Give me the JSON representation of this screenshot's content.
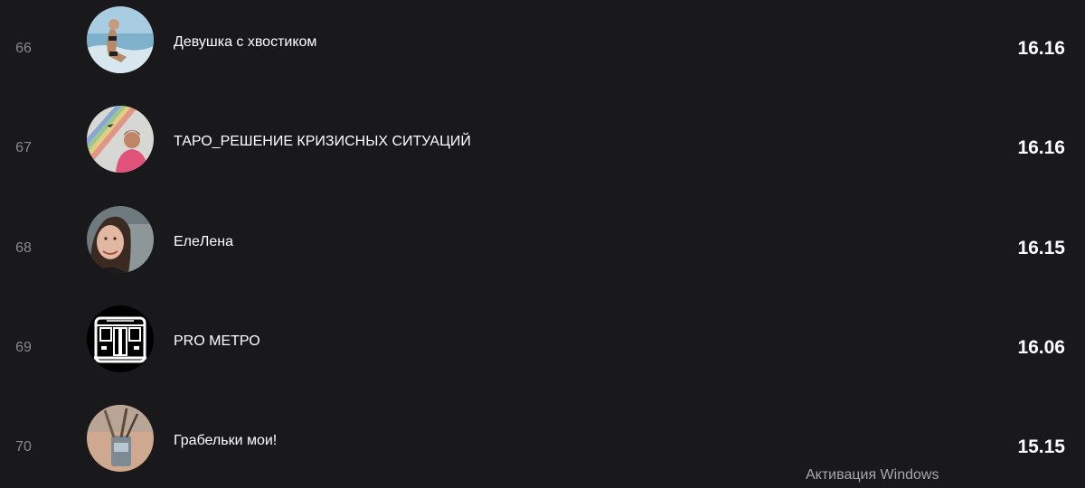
{
  "rows": [
    {
      "rank": "66",
      "name": "Девушка с хвостиком",
      "score": "16.16"
    },
    {
      "rank": "67",
      "name": "ТАРО_РЕШЕНИЕ КРИЗИСНЫХ СИТУАЦИЙ",
      "score": "16.16"
    },
    {
      "rank": "68",
      "name": "ЕлеЛена",
      "score": "16.15"
    },
    {
      "rank": "69",
      "name": "PRO МЕТРО",
      "score": "16.06"
    },
    {
      "rank": "70",
      "name": "Грабельки мои!",
      "score": "15.15"
    }
  ],
  "watermark": "Активация Windows",
  "colors": {
    "background": "#19181b",
    "rank_text": "#8a888d",
    "primary_text": "#ffffff",
    "watermark_text": "#a7a6a9"
  }
}
